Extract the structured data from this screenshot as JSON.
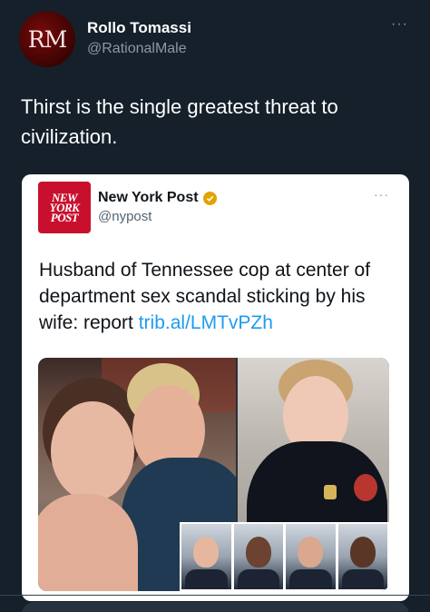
{
  "author": {
    "avatar_text": "RM",
    "name": "Rollo Tomassi",
    "handle": "@RationalMale"
  },
  "tweet": {
    "text": "Thirst is the single greatest threat to civilization.",
    "more_icon": "more-horizontal-icon"
  },
  "quoted": {
    "logo_lines": [
      "NEW",
      "YORK",
      "POST"
    ],
    "name": "New York Post",
    "handle": "@nypost",
    "verified_icon": "verified-badge-icon",
    "verified_color": "#e2a300",
    "text": "Husband of Tennessee cop at center of department sex scandal sticking by his wife: report ",
    "link": "trib.al/LMTvPZh",
    "link_color": "#1d9bf0",
    "image_alt": "photo collage"
  },
  "colors": {
    "background": "#15202b",
    "secondary_text": "#8b98a5",
    "nyp_red": "#c8102e"
  }
}
